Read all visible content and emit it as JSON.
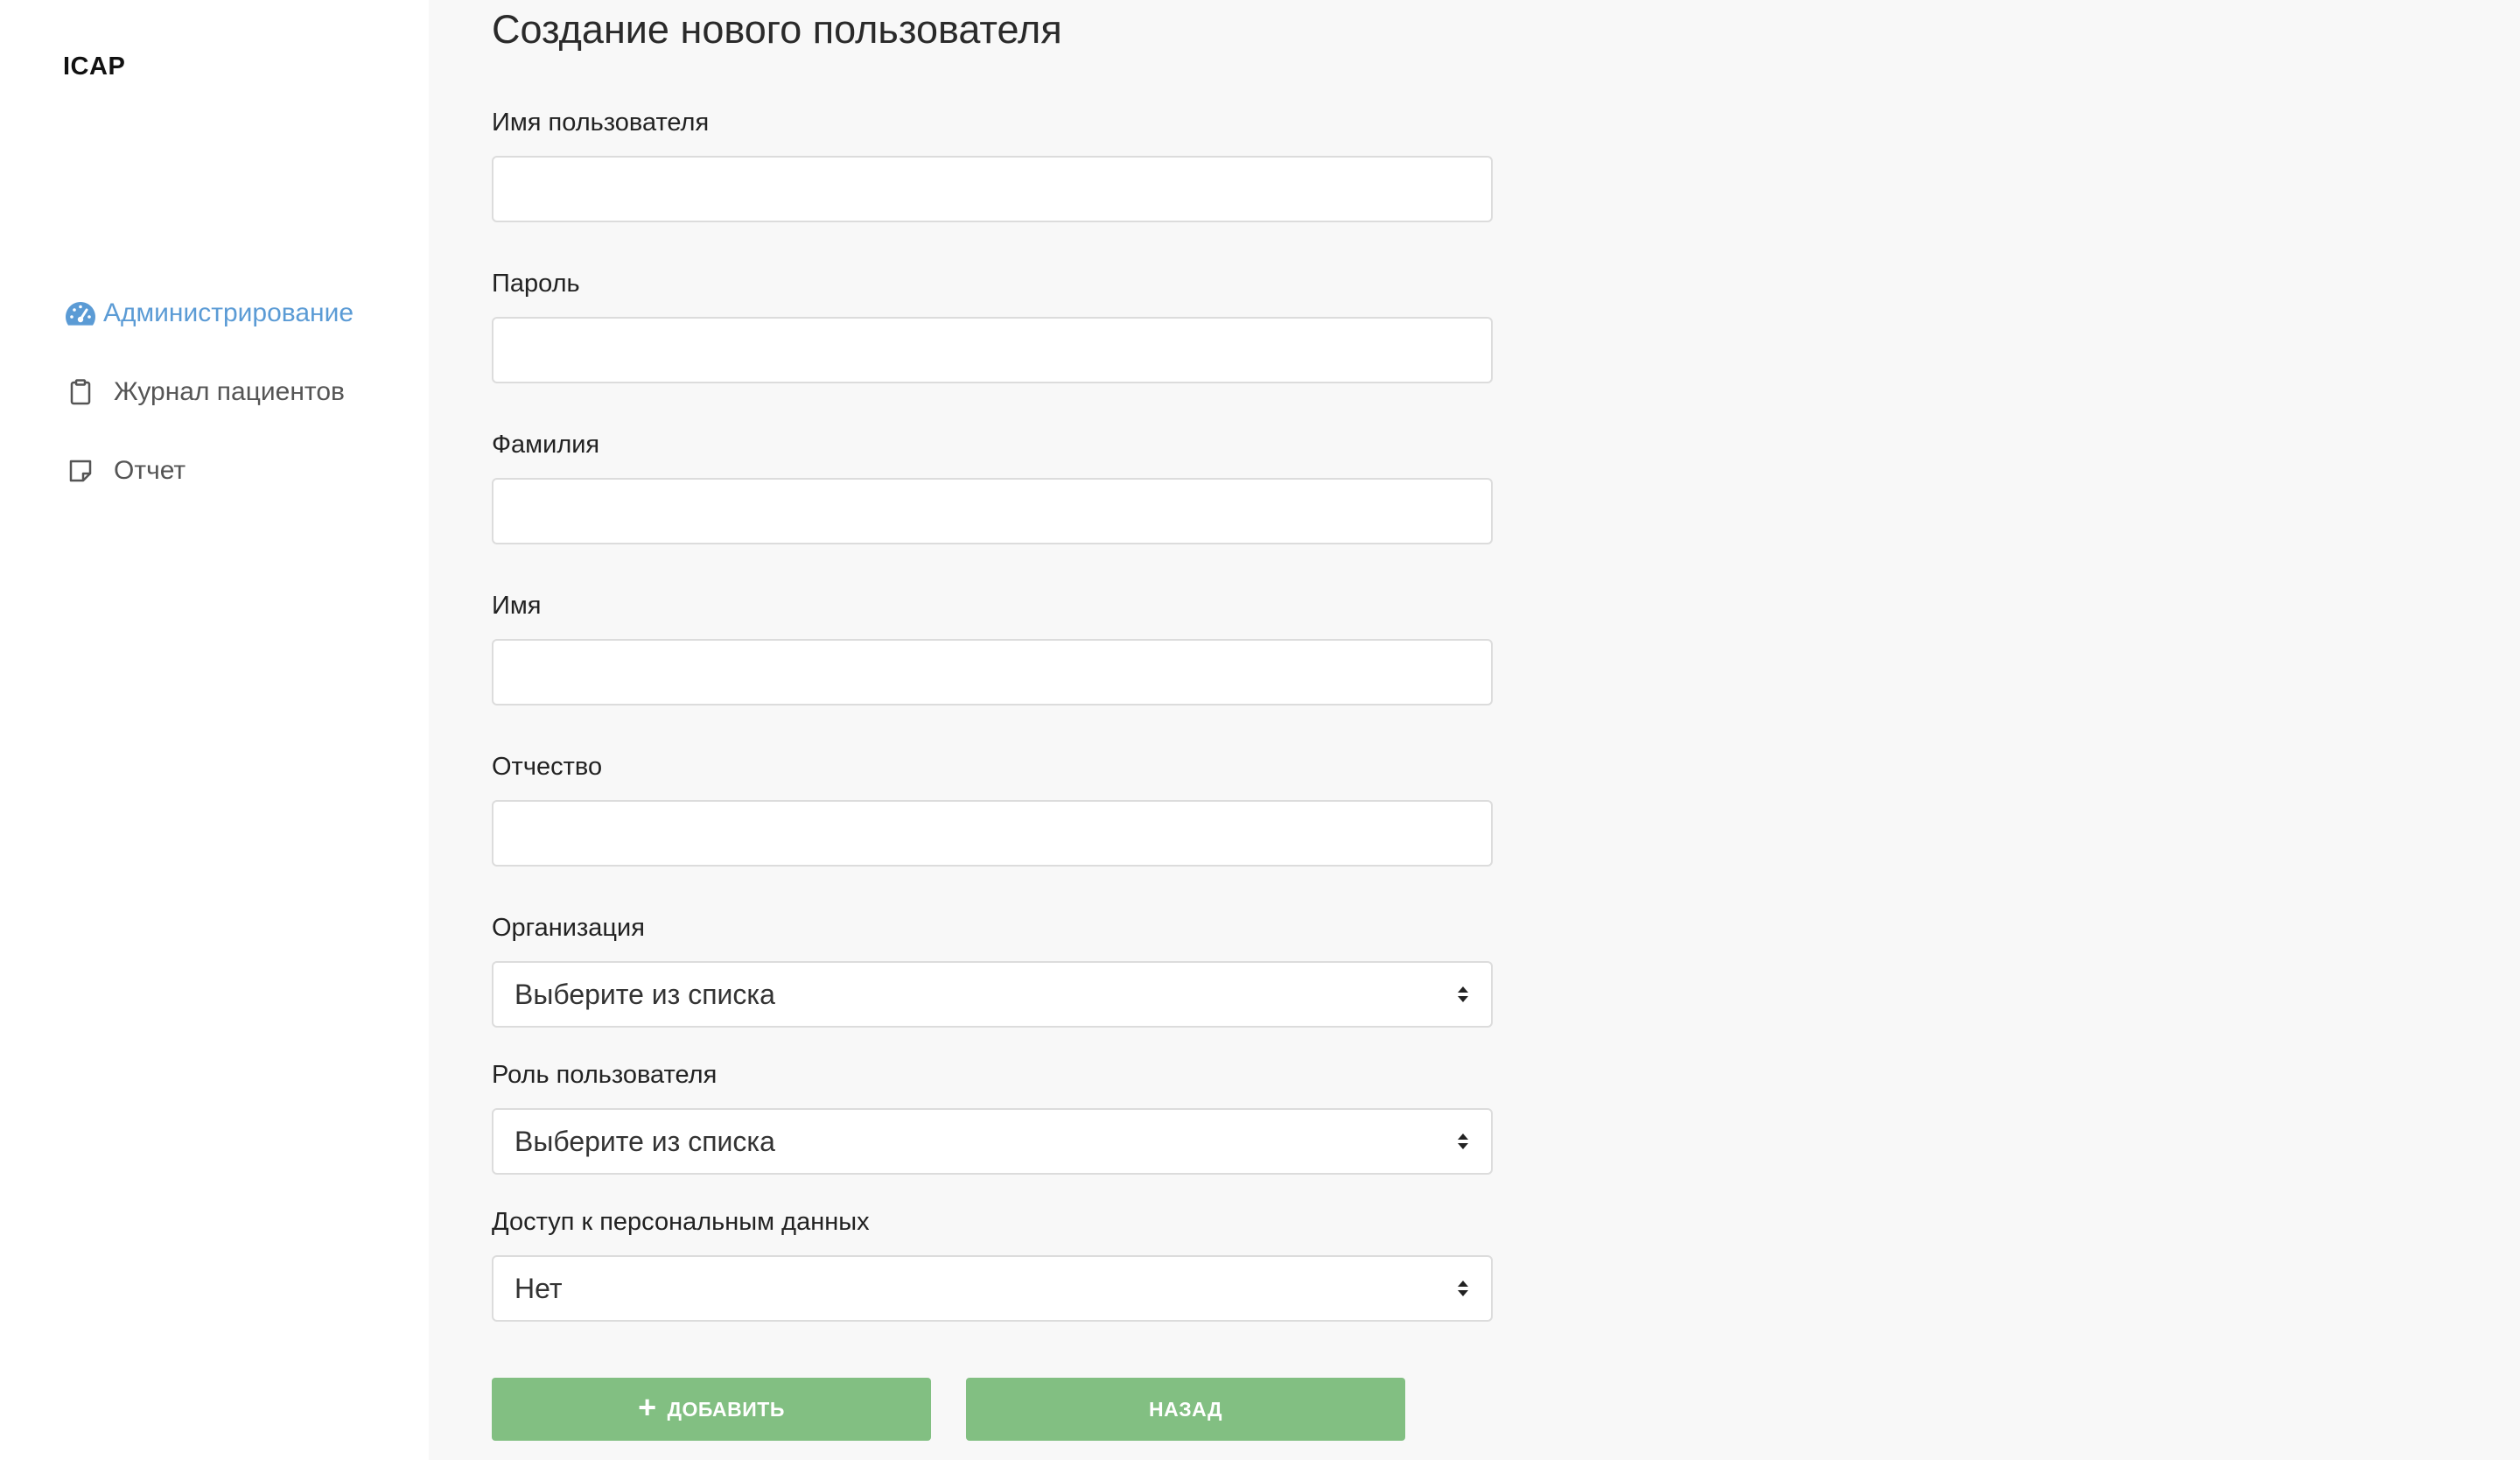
{
  "sidebar": {
    "brand": "ICAP",
    "items": [
      {
        "label": "Администрирование",
        "icon": "dashboard-icon",
        "active": true
      },
      {
        "label": "Журнал пациентов",
        "icon": "clipboard-icon",
        "active": false
      },
      {
        "label": "Отчет",
        "icon": "note-icon",
        "active": false
      }
    ]
  },
  "form": {
    "title": "Создание нового пользователя",
    "fields": {
      "username": {
        "label": "Имя пользователя",
        "value": ""
      },
      "password": {
        "label": "Пароль",
        "value": ""
      },
      "last_name": {
        "label": "Фамилия",
        "value": ""
      },
      "first_name": {
        "label": "Имя",
        "value": ""
      },
      "middle_name": {
        "label": "Отчество",
        "value": ""
      },
      "organization": {
        "label": "Организация",
        "selected": "Выберите из списка"
      },
      "role": {
        "label": "Роль пользователя",
        "selected": "Выберите из списка"
      },
      "personal_data_access": {
        "label": "Доступ к персональным данных",
        "selected": "Нет"
      }
    },
    "buttons": {
      "add_label": "ДОБАВИТЬ",
      "add_icon": "plus-icon",
      "back_label": "НАЗАД"
    }
  },
  "colors": {
    "accent": "#5b9bd5",
    "button": "#82bf82",
    "background": "#f8f8f8"
  }
}
